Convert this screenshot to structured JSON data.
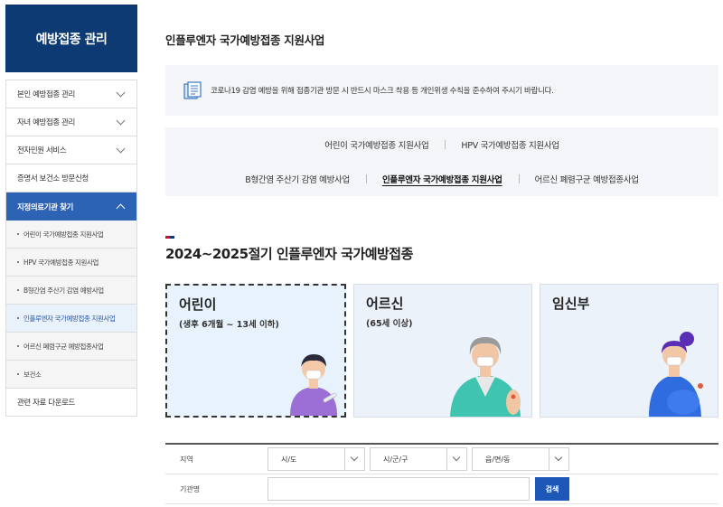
{
  "sidebar": {
    "title": "예방접종 관리",
    "items": [
      {
        "label": "본인 예방접종 관리"
      },
      {
        "label": "자녀 예방접종 관리"
      },
      {
        "label": "전자민원 서비스"
      },
      {
        "label": "증명서 보건소 방문신청"
      },
      {
        "label": "지정의료기관 찾기"
      }
    ],
    "subitems": [
      {
        "label": "어린이 국가예방접종 지원사업"
      },
      {
        "label": "HPV 국가예방접종 지원사업"
      },
      {
        "label": "B형간염 주산기 감염 예방사업"
      },
      {
        "label": "인플루엔자 국가예방접종 지원사업"
      },
      {
        "label": "어르신 폐렴구균 예방접종사업"
      },
      {
        "label": "보건소"
      }
    ],
    "last_item": {
      "label": "관련 자료 다운로드"
    }
  },
  "main": {
    "title": "인플루엔자 국가예방접종 지원사업",
    "notice": "코로나19 감염 예방을 위해 접종기관 방문 시 반드시 마스크 착용 등 개인위생 수칙을 준수하여 주시기 바랍니다.",
    "tabs_row1": [
      "어린이 국가예방접종 지원사업",
      "HPV 국가예방접종 지원사업"
    ],
    "tabs_row2": [
      "B형간염 주산기 감염 예방사업",
      "인플루엔자 국가예방접종 지원사업",
      "어르신 폐렴구균 예방접종사업"
    ],
    "season_title": "2024~2025절기 인플루엔자 국가예방접종",
    "cards": [
      {
        "title": "어린이",
        "sub": "(생후 6개월 ~ 13세 이하)"
      },
      {
        "title": "어르신",
        "sub": "(65세 이상)"
      },
      {
        "title": "임신부",
        "sub": ""
      }
    ]
  },
  "search": {
    "region_label": "지역",
    "sido": "시/도",
    "sigungu": "시/군/구",
    "eupmyeondong": "읍/면/동",
    "org_label": "기관명",
    "search_button": "검색"
  },
  "colors": {
    "sidebar_head": "#0e3a73",
    "active_blue": "#2c63b5",
    "button_blue": "#1d57b8"
  }
}
